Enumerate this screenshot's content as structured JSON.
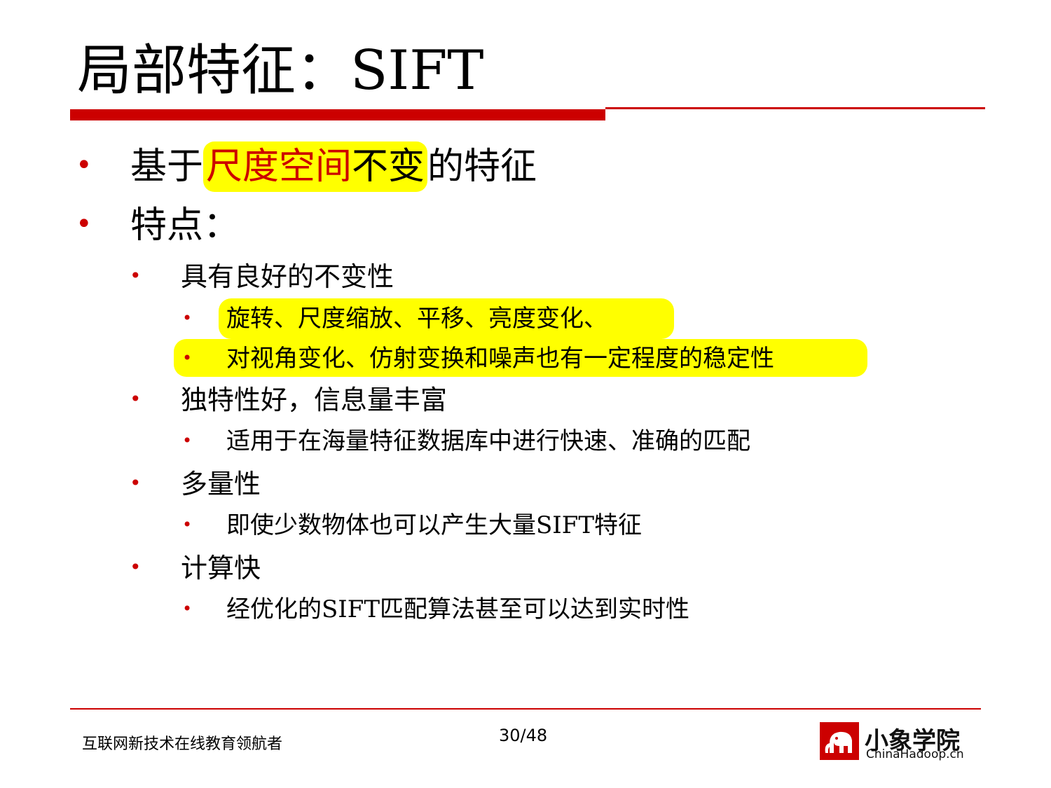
{
  "slide": {
    "title": "局部特征：SIFT",
    "bullets": [
      {
        "level": 1,
        "parts": [
          "基于",
          "尺度空间",
          "不变",
          "的特征"
        ]
      },
      {
        "level": 1,
        "text": "特点："
      },
      {
        "level": 2,
        "text": "具有良好的不变性"
      },
      {
        "level": 3,
        "text": "旋转、尺度缩放、平移、亮度变化、"
      },
      {
        "level": 3,
        "text": "对视角变化、仿射变换和噪声也有一定程度的稳定性"
      },
      {
        "level": 2,
        "text": "独特性好，信息量丰富"
      },
      {
        "level": 3,
        "text": "适用于在海量特征数据库中进行快速、准确的匹配"
      },
      {
        "level": 2,
        "text": "多量性"
      },
      {
        "level": 3,
        "text": "即使少数物体也可以产生大量SIFT特征"
      },
      {
        "level": 2,
        "text": "计算快"
      },
      {
        "level": 3,
        "text": "经优化的SIFT匹配算法甚至可以达到实时性"
      }
    ],
    "bullet_glyph": "•"
  },
  "footer": {
    "slogan": "互联网新技术在线教育领航者",
    "page": "30/48",
    "logo_name": "小象学院",
    "logo_url": "ChinaHadoop.cn"
  },
  "colors": {
    "accent": "#cc0000",
    "highlight": "#ffff00"
  }
}
